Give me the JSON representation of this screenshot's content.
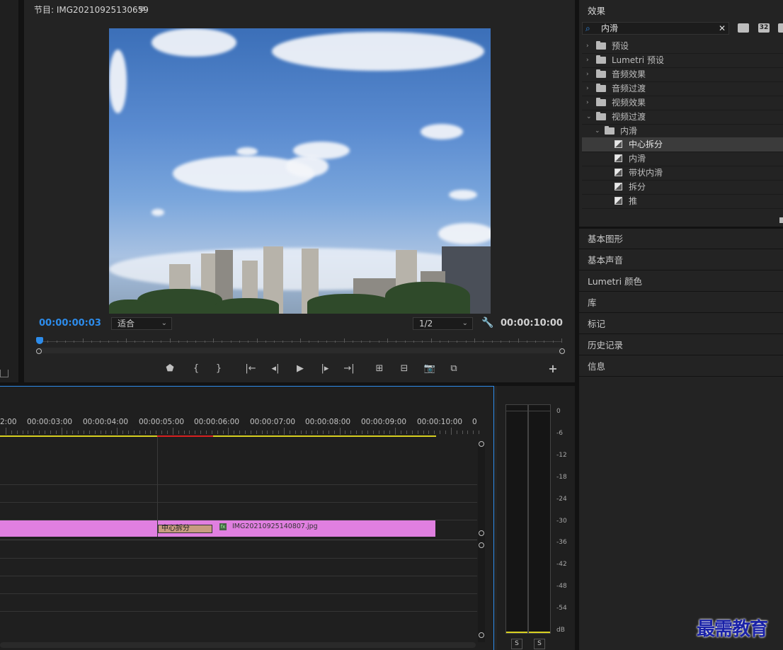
{
  "program": {
    "title": "节目: IMG20210925130659",
    "menu_icon": "hamburger-icon",
    "current_time": "00:00:00:03",
    "fit_label": "适合",
    "resolution_label": "1/2",
    "duration": "00:00:10:00",
    "playhead_fraction": 0.003
  },
  "controls": [
    "marker-icon",
    "in-point-icon",
    "out-point-icon",
    "go-to-in-icon",
    "step-back-icon",
    "play-icon",
    "step-forward-icon",
    "go-to-out-icon",
    "lift-icon",
    "extract-icon",
    "export-frame-icon",
    "comparison-view-icon",
    "add-button-icon"
  ],
  "effects": {
    "title": "效果",
    "search_value": "内滑",
    "badge_32": "32",
    "tree": [
      {
        "label": "预设",
        "type": "preset"
      },
      {
        "label": "Lumetri 预设",
        "type": "preset"
      },
      {
        "label": "音频效果",
        "type": "folder"
      },
      {
        "label": "音频过渡",
        "type": "folder"
      },
      {
        "label": "视频效果",
        "type": "folder"
      },
      {
        "label": "视频过渡",
        "type": "folder-open"
      },
      {
        "label": "内滑",
        "type": "subfolder-open"
      },
      {
        "label": "中心拆分",
        "type": "transition",
        "selected": true
      },
      {
        "label": "内滑",
        "type": "transition"
      },
      {
        "label": "带状内滑",
        "type": "transition"
      },
      {
        "label": "拆分",
        "type": "transition"
      },
      {
        "label": "推",
        "type": "transition"
      }
    ]
  },
  "side_panels": [
    "基本图形",
    "基本声音",
    "Lumetri 颜色",
    "库",
    "标记",
    "历史记录",
    "信息"
  ],
  "timeline": {
    "ruler": [
      "2:00",
      "00:00:03:00",
      "00:00:04:00",
      "00:00:05:00",
      "00:00:06:00",
      "00:00:07:00",
      "00:00:08:00",
      "00:00:09:00",
      "00:00:10:00",
      "0"
    ],
    "transition_label": "中心拆分",
    "clip_name": "IMG20210925140807.jpg",
    "fx_badge": "fx"
  },
  "audio_meter": {
    "labels": [
      "0",
      "-6",
      "-12",
      "-18",
      "-24",
      "-30",
      "-36",
      "-42",
      "-48",
      "-54",
      "dB"
    ],
    "solo_left": "S",
    "solo_right": "S"
  },
  "watermark": "最需教育",
  "colors": {
    "accent": "#2d8ceb",
    "clip": "#e07fe0",
    "transition": "#c79c80",
    "render_yellow": "#d8d020",
    "render_red": "#d82020"
  }
}
